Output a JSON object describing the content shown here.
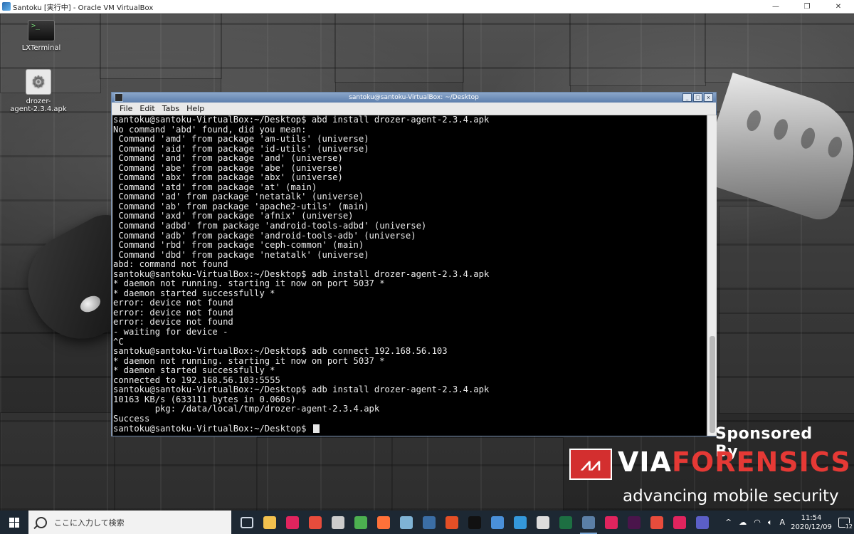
{
  "host_window": {
    "title": "Santoku [実行中] - Oracle VM VirtualBox",
    "controls": {
      "minimize": "—",
      "restore": "❐",
      "close": "✕"
    }
  },
  "desktop": {
    "icons": [
      {
        "label": "LXTerminal",
        "icon": "terminal-icon",
        "glyph": ">_"
      },
      {
        "label": "drozer-agent-2.3.4.apk",
        "label_lines": [
          "drozer-",
          "agent-2.3.4.apk"
        ],
        "icon": "settings-gear-icon"
      }
    ],
    "sponsor": {
      "sponsored_by": "Sponsored By",
      "brand_via": "VIA",
      "brand_forensics": "FORENSICS",
      "tagline": "advancing mobile security",
      "colors": {
        "brand_red": "#e53935",
        "text": "#ffffff"
      }
    }
  },
  "terminal": {
    "title": "santoku@santoku-VirtualBox: ~/Desktop",
    "menu": [
      "File",
      "Edit",
      "Tabs",
      "Help"
    ],
    "lines": [
      "santoku@santoku-VirtualBox:~/Desktop$ abd install drozer-agent-2.3.4.apk",
      "No command 'abd' found, did you mean:",
      " Command 'amd' from package 'am-utils' (universe)",
      " Command 'aid' from package 'id-utils' (universe)",
      " Command 'and' from package 'and' (universe)",
      " Command 'abe' from package 'abe' (universe)",
      " Command 'abx' from package 'abx' (universe)",
      " Command 'atd' from package 'at' (main)",
      " Command 'ad' from package 'netatalk' (universe)",
      " Command 'ab' from package 'apache2-utils' (main)",
      " Command 'axd' from package 'afnix' (universe)",
      " Command 'adbd' from package 'android-tools-adbd' (universe)",
      " Command 'adb' from package 'android-tools-adb' (universe)",
      " Command 'rbd' from package 'ceph-common' (main)",
      " Command 'dbd' from package 'netatalk' (universe)",
      "abd: command not found",
      "santoku@santoku-VirtualBox:~/Desktop$ adb install drozer-agent-2.3.4.apk",
      "* daemon not running. starting it now on port 5037 *",
      "* daemon started successfully *",
      "error: device not found",
      "error: device not found",
      "error: device not found",
      "- waiting for device -",
      "^C",
      "santoku@santoku-VirtualBox:~/Desktop$ adb connect 192.168.56.103",
      "* daemon not running. starting it now on port 5037 *",
      "* daemon started successfully *",
      "connected to 192.168.56.103:5555",
      "santoku@santoku-VirtualBox:~/Desktop$ adb install drozer-agent-2.3.4.apk",
      "10163 KB/s (633111 bytes in 0.060s)",
      "        pkg: /data/local/tmp/drozer-agent-2.3.4.apk",
      "Success"
    ],
    "prompt": "santoku@santoku-VirtualBox:~/Desktop$ ",
    "colors": {
      "background": "#000000",
      "text": "#ececec"
    }
  },
  "taskbar": {
    "search_placeholder": "ここに入力して検索",
    "apps": [
      {
        "name": "task-view-icon",
        "color": "#1d2833"
      },
      {
        "name": "file-explorer-icon",
        "color": "#f2c14e"
      },
      {
        "name": "app-pink-icon",
        "color": "#e0245e"
      },
      {
        "name": "app-sync-icon",
        "color": "#e74c3c"
      },
      {
        "name": "inkscape-icon",
        "color": "#cccccc"
      },
      {
        "name": "chrome-icon",
        "color": "#4caf50"
      },
      {
        "name": "firefox-icon",
        "color": "#ff7139"
      },
      {
        "name": "app-blue-icon",
        "color": "#7fb3d5"
      },
      {
        "name": "app-pen-icon",
        "color": "#3b6ea5"
      },
      {
        "name": "app-red-icon",
        "color": "#e34f26"
      },
      {
        "name": "terminal-icon",
        "color": "#111111"
      },
      {
        "name": "app-photo-icon",
        "color": "#4a90d9"
      },
      {
        "name": "app-network-icon",
        "color": "#3498db"
      },
      {
        "name": "security-shield-icon",
        "color": "#dddddd"
      },
      {
        "name": "excel-icon",
        "color": "#1d6f42"
      },
      {
        "name": "virtualbox-icon",
        "color": "#5b7fa6"
      },
      {
        "name": "app-dots-icon",
        "color": "#e0245e"
      },
      {
        "name": "slack-icon",
        "color": "#4a154b"
      },
      {
        "name": "app-swirl-icon",
        "color": "#e74c3c"
      },
      {
        "name": "app-rings-icon",
        "color": "#e0245e"
      },
      {
        "name": "teams-icon",
        "color": "#5b5fc7"
      }
    ],
    "tray": {
      "chevron": "^",
      "ime": "A",
      "time": "11:54",
      "date": "2020/12/09",
      "notifications": "12"
    },
    "colors": {
      "background": "#1d2833",
      "search_bg": "#f2f2f2"
    }
  }
}
